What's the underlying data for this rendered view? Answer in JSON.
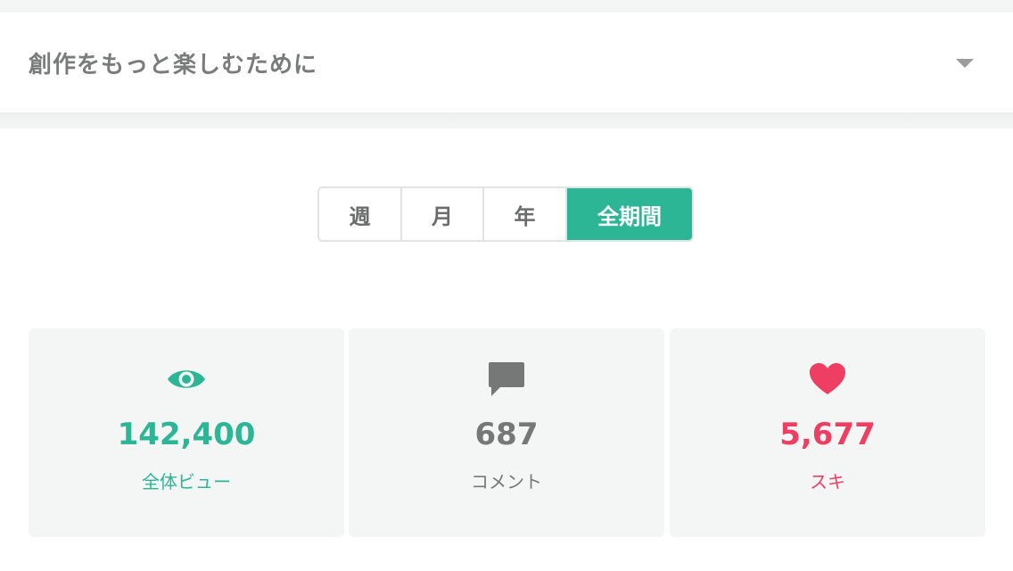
{
  "header": {
    "title": "創作をもっと楽しむために",
    "toggle_icon": "chevron-down-icon"
  },
  "period_tabs": {
    "items": [
      "週",
      "月",
      "年",
      "全期間"
    ],
    "selected": "全期間"
  },
  "stats": [
    {
      "icon": "eye-icon",
      "value": "142,400",
      "label": "全体ビュー",
      "color": "#2cb696"
    },
    {
      "icon": "comment-icon",
      "value": "687",
      "label": "コメント",
      "color": "#767877"
    },
    {
      "icon": "heart-icon",
      "value": "5,677",
      "label": "スキ",
      "color": "#ee3f63"
    }
  ],
  "colors": {
    "accent": "#2cb696",
    "like": "#ee3f63",
    "text_muted": "#767877",
    "card_bg": "#f4f6f5"
  }
}
